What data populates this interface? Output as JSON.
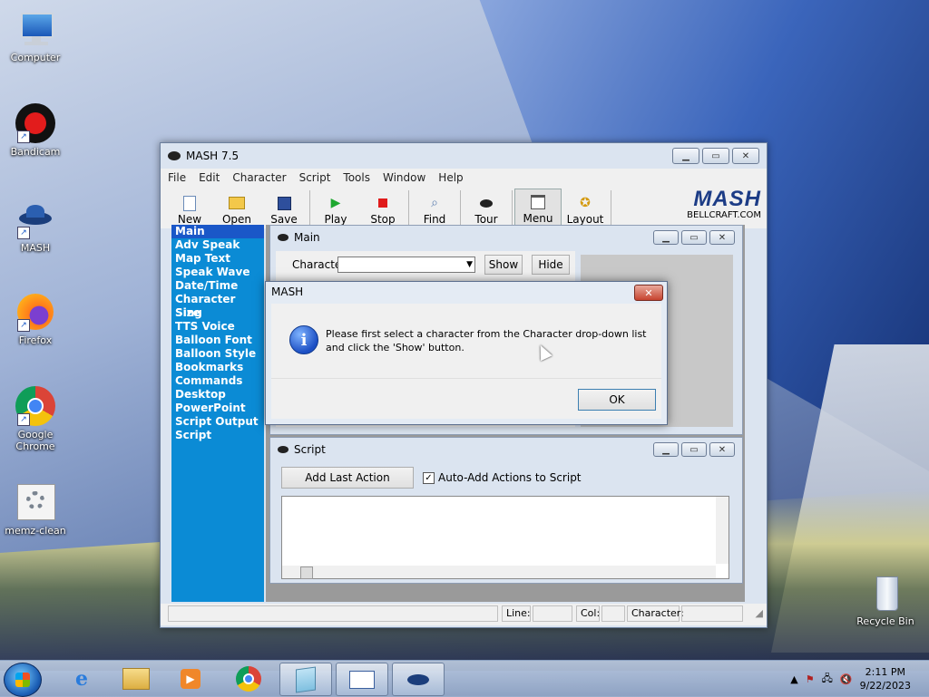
{
  "desktop": {
    "icons": [
      {
        "label": "Computer",
        "icon": "computer-icon"
      },
      {
        "label": "Bandicam",
        "icon": "bandicam-icon"
      },
      {
        "label": "MASH",
        "icon": "mash-icon"
      },
      {
        "label": "Firefox",
        "icon": "firefox-icon"
      },
      {
        "label": "Google Chrome",
        "icon": "chrome-icon"
      },
      {
        "label": "memz-clean",
        "icon": "gear-file-icon"
      },
      {
        "label": "Recycle Bin",
        "icon": "recycle-bin-icon"
      }
    ]
  },
  "window": {
    "title": "MASH 7.5",
    "menu": [
      "File",
      "Edit",
      "Character",
      "Script",
      "Tools",
      "Window",
      "Help"
    ],
    "toolbar": [
      "New",
      "Open",
      "Save",
      "Play",
      "Stop",
      "Find",
      "Tour",
      "Menu",
      "Layout"
    ],
    "logo_text": "MASH",
    "logo_sub": "BELLCRAFT.COM"
  },
  "sidebar": {
    "items": [
      "Main",
      "Adv Speak",
      "Map Text",
      "Speak Wave",
      "Date/Time",
      "Character Size",
      "Sing",
      "TTS Voice",
      "Balloon Font",
      "Balloon Style",
      "Bookmarks",
      "Commands",
      "Desktop",
      "PowerPoint",
      "Script Output",
      "Script"
    ]
  },
  "main_panel": {
    "title": "Main",
    "character_label": "Character",
    "character_value": "",
    "show_label": "Show",
    "hide_label": "Hide"
  },
  "script_panel": {
    "title": "Script",
    "add_last_action": "Add Last Action",
    "auto_add_label": "Auto-Add Actions to Script",
    "auto_add_checked": true
  },
  "statusbar": {
    "line_label": "Line:",
    "col_label": "Col:",
    "character_label": "Character:"
  },
  "dialog": {
    "title": "MASH",
    "message": "Please first select a character from the Character drop-down list and click the 'Show' button.",
    "ok_label": "OK"
  },
  "taskbar": {
    "time": "2:11 PM",
    "date": "9/22/2023"
  }
}
